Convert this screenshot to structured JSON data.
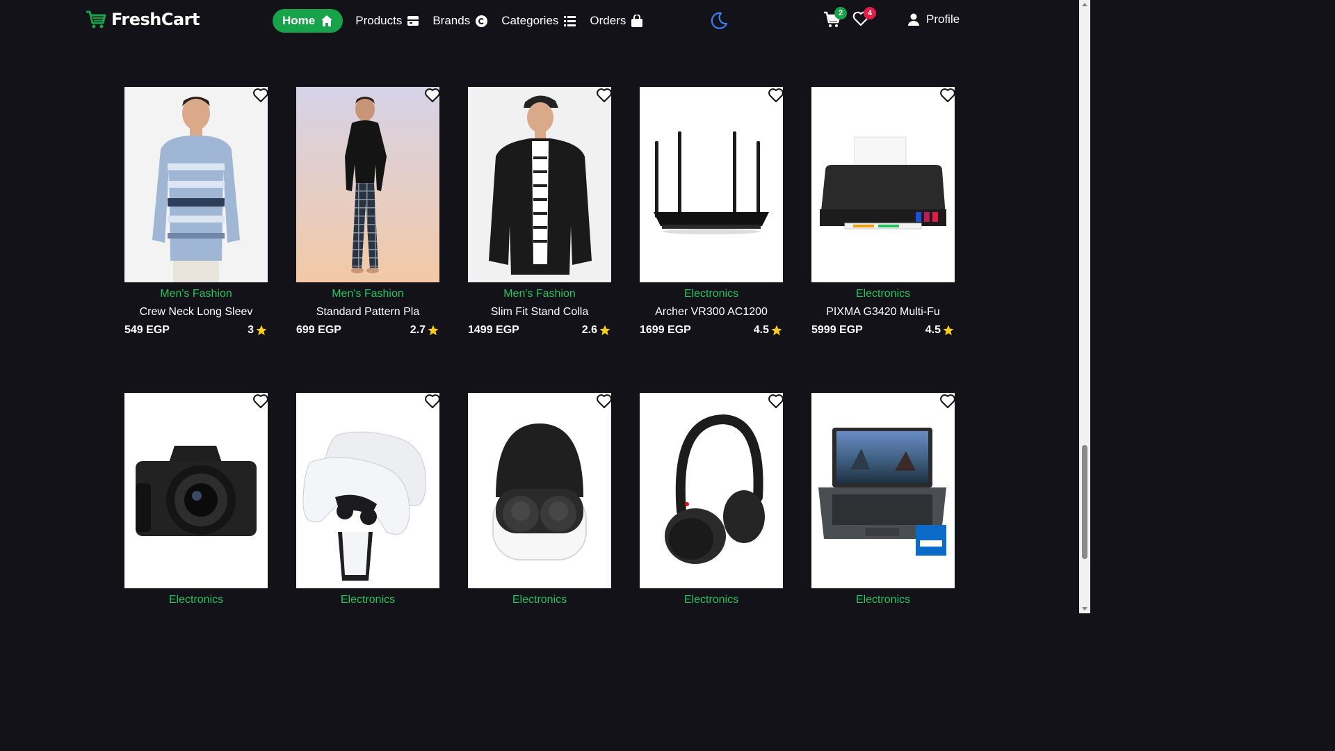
{
  "brand": {
    "name": "FreshCart"
  },
  "nav": {
    "home": "Home",
    "products": "Products",
    "brands": "Brands",
    "categories": "Categories",
    "orders": "Orders"
  },
  "cart_count": "2",
  "wishlist_count": "4",
  "profile_label": "Profile",
  "colors": {
    "accent": "#16a34a",
    "badge_red": "#e11d48",
    "star": "#facc15",
    "background": "#121218"
  },
  "products": [
    {
      "category": "Men's Fashion",
      "title": "Crew Neck Long Sleev",
      "price": "549 EGP",
      "rating": "3",
      "icon": "sweater-photo"
    },
    {
      "category": "Men's Fashion",
      "title": "Standard Pattern Pla",
      "price": "699 EGP",
      "rating": "2.7",
      "icon": "pajama-photo"
    },
    {
      "category": "Men's Fashion",
      "title": "Slim Fit Stand Colla",
      "price": "1499 EGP",
      "rating": "2.6",
      "icon": "leather-jacket-photo"
    },
    {
      "category": "Electronics",
      "title": "Archer VR300 AC1200",
      "price": "1699 EGP",
      "rating": "4.5",
      "icon": "router-photo"
    },
    {
      "category": "Electronics",
      "title": "PIXMA G3420 Multi-Fu",
      "price": "5999 EGP",
      "rating": "4.5",
      "icon": "printer-photo"
    },
    {
      "category": "Electronics",
      "title": "",
      "price": "",
      "rating": "",
      "icon": "camera-photo"
    },
    {
      "category": "Electronics",
      "title": "",
      "price": "",
      "rating": "",
      "icon": "controllers-photo"
    },
    {
      "category": "Electronics",
      "title": "",
      "price": "",
      "rating": "",
      "icon": "earbuds-photo"
    },
    {
      "category": "Electronics",
      "title": "",
      "price": "",
      "rating": "",
      "icon": "headphones-photo"
    },
    {
      "category": "Electronics",
      "title": "",
      "price": "",
      "rating": "",
      "icon": "laptop-photo"
    }
  ]
}
